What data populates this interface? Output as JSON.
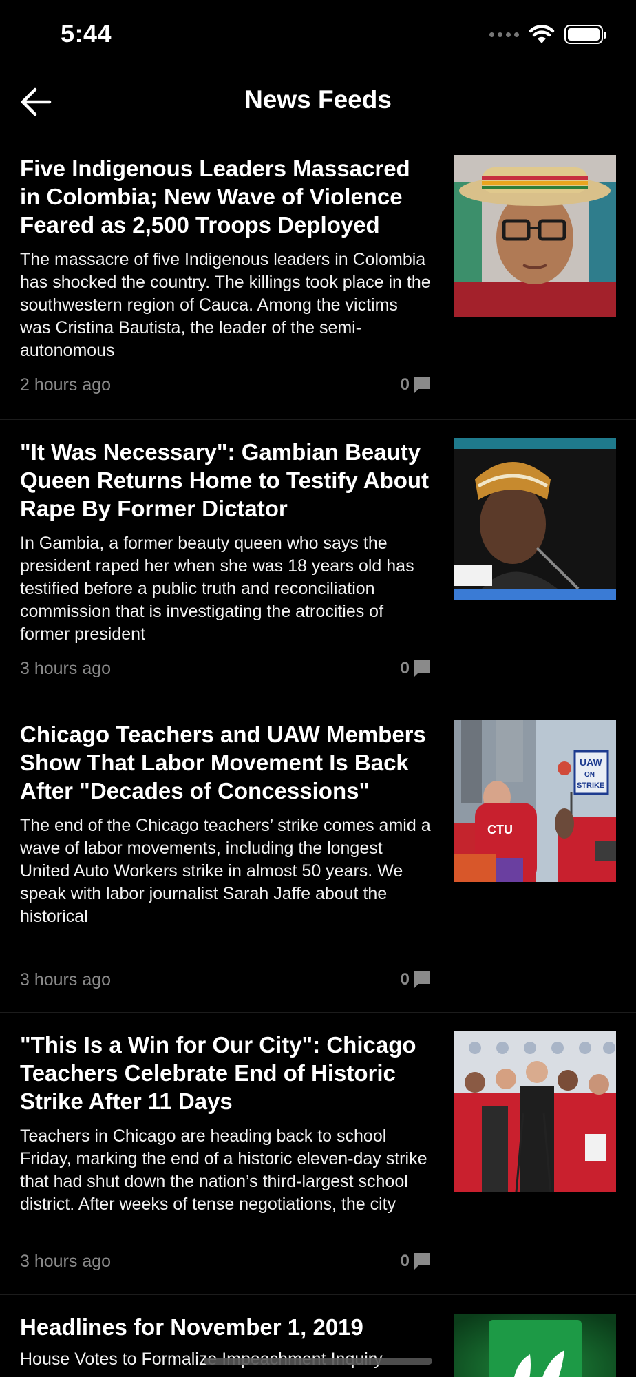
{
  "status": {
    "time": "5:44"
  },
  "nav": {
    "title": "News Feeds"
  },
  "articles": [
    {
      "title": "Five Indigenous Leaders Massacred in Colombia; New Wave of Violence Feared as 2,500 Troops Deployed",
      "summary": "The massacre of five Indigenous leaders in Colombia has shocked the country. The killings took place in the southwestern region of Cauca. Among the victims was Cristina Bautista, the leader of the semi-autonomous",
      "time": "2 hours ago",
      "comments": "0"
    },
    {
      "title": "\"It Was Necessary\": Gambian Beauty Queen Returns Home to Testify About Rape By Former Dictator",
      "summary": "In Gambia, a former beauty queen who says the president raped her when she was 18 years old has testified before a public truth and reconciliation commission that is investigating the atrocities of former president",
      "time": "3 hours ago",
      "comments": "0"
    },
    {
      "title": "Chicago Teachers and UAW Members Show That Labor Movement Is Back After \"Decades of Concessions\"",
      "summary": "The end of the Chicago teachers’ strike comes amid a wave of labor movements, including the longest United Auto Workers strike in almost 50 years. We speak with labor journalist Sarah Jaffe about the historical",
      "time": "3 hours ago",
      "comments": "0",
      "image_text": {
        "sign_ctu": "CTU",
        "sign_uaw": "UAW",
        "sign_on": "ON",
        "sign_strike": "STRIKE"
      }
    },
    {
      "title": "\"This Is a Win for Our City\": Chicago Teachers Celebrate End of Historic Strike After 11 Days",
      "summary": "Teachers in Chicago are heading back to school Friday, marking the end of a historic eleven-day strike that had shut down the nation’s third-largest school district. After weeks of tense negotiations, the city",
      "time": "3 hours ago",
      "comments": "0"
    },
    {
      "title": "Headlines for November  1, 2019",
      "summary": "House Votes to Formalize Impeachment Inquiry"
    }
  ],
  "colors": {
    "background": "#000000",
    "meta_text": "#8a8a8a"
  }
}
